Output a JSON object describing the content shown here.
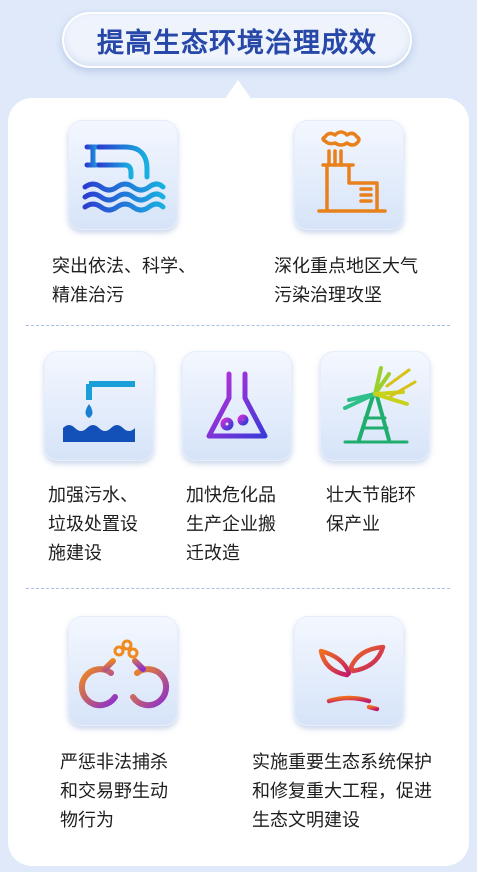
{
  "title": "提高生态环境治理成效",
  "items": [
    {
      "label": "突出依法、科学、\n精准治污",
      "icon": "pipe-water-icon"
    },
    {
      "label": "深化重点地区大气\n污染治理攻坚",
      "icon": "factory-smoke-icon"
    },
    {
      "label": "加强污水、\n垃圾处置设\n施建设",
      "icon": "faucet-drop-icon"
    },
    {
      "label": "加快危化品\n生产企业搬\n迁改造",
      "icon": "chemical-flask-icon"
    },
    {
      "label": "壮大节能环\n保产业",
      "icon": "wind-turbine-icon"
    },
    {
      "label": "严惩非法捕杀\n和交易野生动\n物行为",
      "icon": "handcuffs-icon"
    },
    {
      "label": "实施重要生态系统保护\n和修复重大工程，促进\n生态文明建设",
      "icon": "sprout-icon"
    }
  ]
}
